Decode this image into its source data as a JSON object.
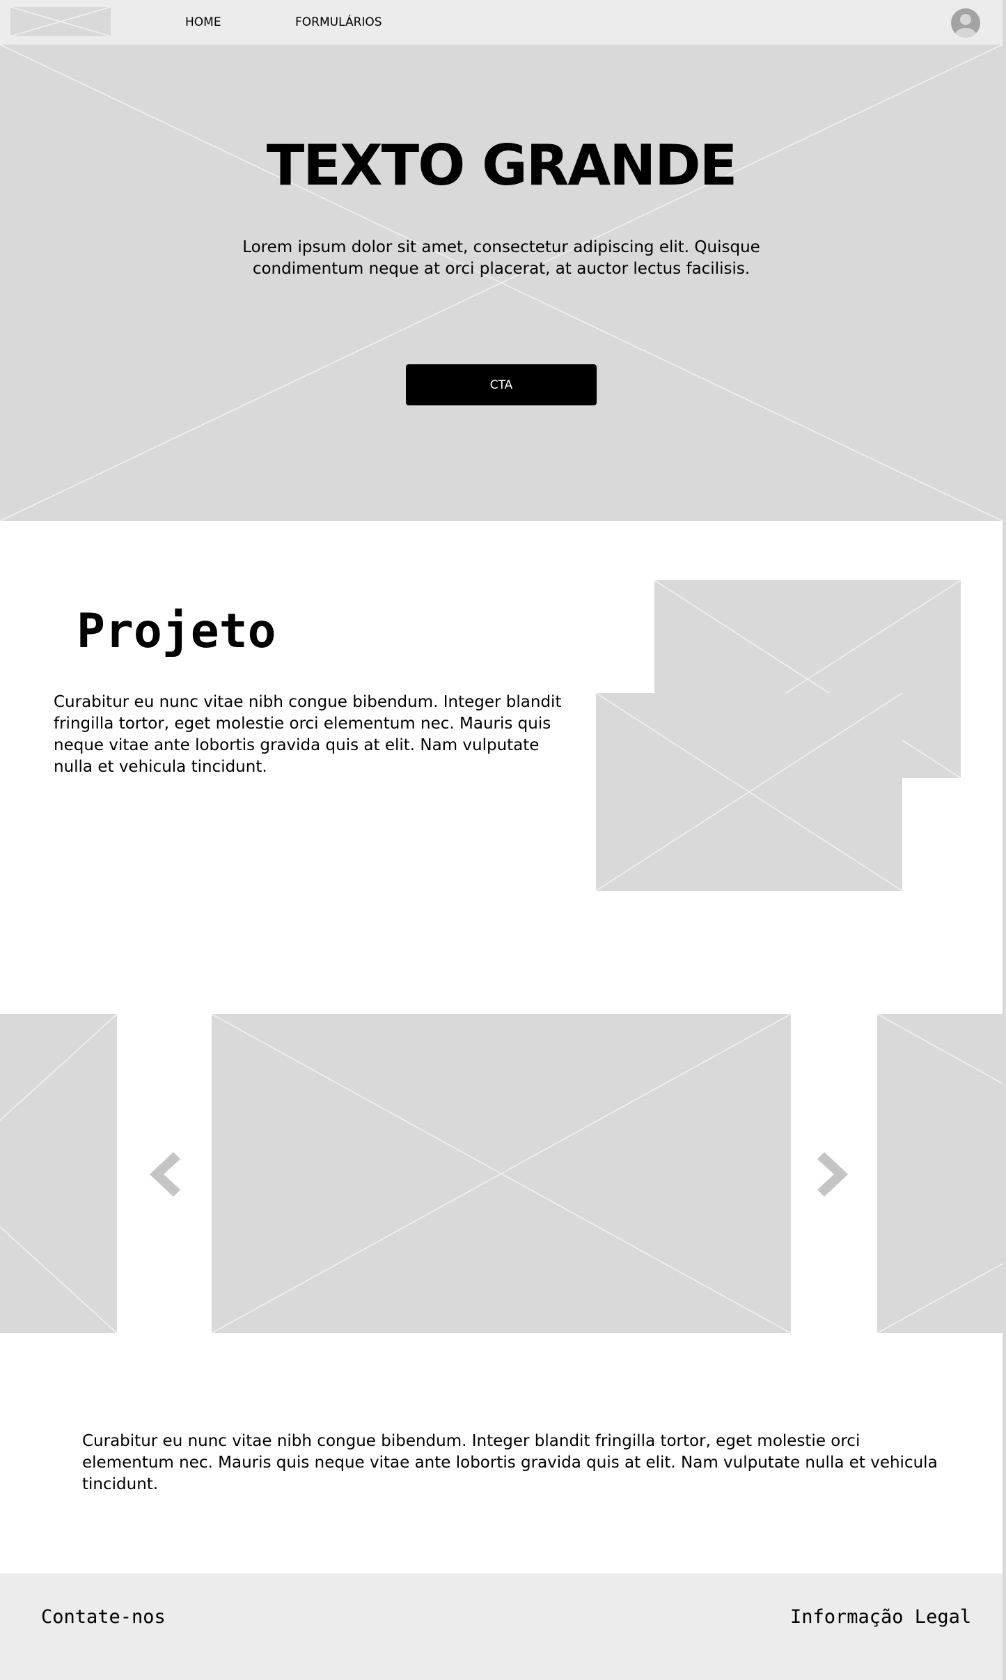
{
  "header": {
    "nav": [
      "HOME",
      "FORMULÁRIOS"
    ],
    "logo_icon": "image-placeholder-icon",
    "avatar_icon": "user-avatar-icon"
  },
  "hero": {
    "title": "TEXTO GRANDE",
    "text": "Lorem ipsum dolor sit amet, consectetur adipiscing elit. Quisque condimentum neque at orci placerat, at auctor lectus facilisis.",
    "cta_label": "CTA"
  },
  "project": {
    "title": "Projeto",
    "text": "Curabitur eu nunc vitae nibh congue bibendum. Integer blandit fringilla  tortor, eget molestie orci elementum nec. Mauris quis neque vitae ante  lobortis gravida quis at elit. Nam vulputate nulla et vehicula  tincidunt."
  },
  "carousel": {
    "prev_icon": "chevron-left-icon",
    "next_icon": "chevron-right-icon"
  },
  "bottom": {
    "text": "Curabitur eu nunc vitae nibh congue bibendum. Integer blandit fringilla  tortor, eget molestie orci elementum nec. Mauris quis neque vitae ante  lobortis gravida quis at elit. Nam vulputate nulla et vehicula  tincidunt."
  },
  "footer": {
    "contact": "Contate-nos",
    "legal": "Informação Legal"
  },
  "colors": {
    "placeholder": "#d9d9d9",
    "header_bg": "#ececec",
    "cta_bg": "#000000",
    "arrow": "#c4c4c4"
  }
}
